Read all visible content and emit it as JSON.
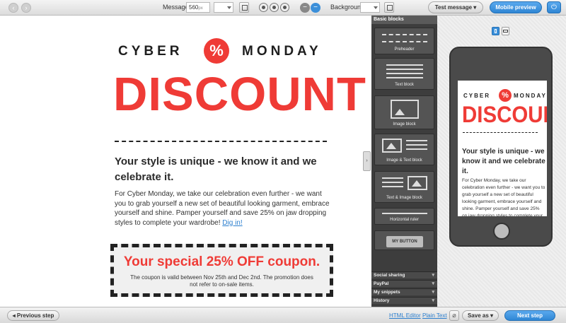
{
  "toolbar": {
    "message_label": "Message",
    "message_width": "560",
    "message_unit": "px",
    "background_label": "Background",
    "test_message": "Test message ▾",
    "mobile_preview": "Mobile preview",
    "power_icon": "power-icon"
  },
  "email": {
    "logo_left": "CYBER",
    "logo_right": "MONDAY",
    "logo_badge": "%",
    "headline": "DISCOUNT",
    "subhead": "Your style is unique - we know it and we celebrate it.",
    "body": "For Cyber Monday, we take our celebration even further - we want you to grab yourself a new set of beautiful looking garment, embrace yourself and shine. Pamper yourself and save 25% on jaw dropping styles to complete your wardrobe!",
    "body_link": "Dig in!",
    "coupon_title": "Your special 25% OFF coupon.",
    "coupon_text": "The coupon is valid between Nov 25th and Dec 2nd. The promotion does not refer to on-sale items."
  },
  "blocks": {
    "header": "Basic blocks",
    "items": [
      {
        "label": "Preheader"
      },
      {
        "label": "Text block"
      },
      {
        "label": "Image block"
      },
      {
        "label": "Image & Text block"
      },
      {
        "label": "Text & Image block"
      },
      {
        "label": "Horizontal ruler"
      },
      {
        "label": "MY BUTTON"
      }
    ],
    "sections": [
      "Social sharing",
      "PayPal",
      "My snippets",
      "History"
    ]
  },
  "preview": {
    "logo_left": "CYBER",
    "logo_right": "MONDAY",
    "logo_badge": "%",
    "headline": "DISCOUNT",
    "subhead": "Your style is unique - we know it and we celebrate it.",
    "body": "For Cyber Monday, we take our celebration even further - we want you to grab yourself a new set of beautiful looking garment, embrace yourself and shine. Pamper yourself and save 25% on jaw dropping styles to complete your wardrobe!"
  },
  "footer": {
    "previous_step": "◂  Previous step",
    "html_editor": "HTML Editor",
    "plain_text": "Plain Text",
    "save_as": "Save as ▾",
    "next_step": "Next step"
  },
  "colors": {
    "accent": "#ef3b36",
    "primary_blue": "#3b8fd9",
    "panel_dark": "#3d3d3d"
  }
}
